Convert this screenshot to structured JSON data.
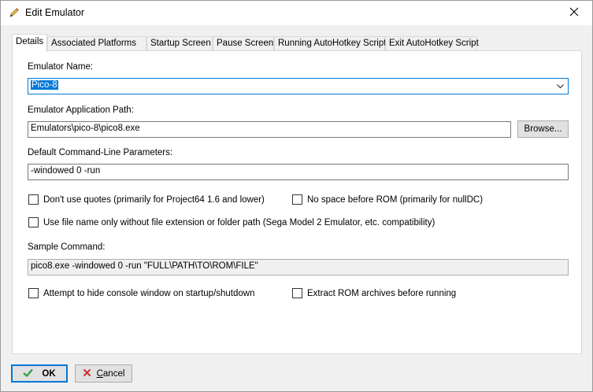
{
  "window": {
    "title": "Edit Emulator",
    "icon": "pencil-icon",
    "close": "close-icon"
  },
  "tabs": [
    {
      "label": "Details",
      "active": true
    },
    {
      "label": "Associated Platforms",
      "active": false
    },
    {
      "label": "Startup Screen",
      "active": false
    },
    {
      "label": "Pause Screen",
      "active": false
    },
    {
      "label": "Running AutoHotkey Script",
      "active": false
    },
    {
      "label": "Exit AutoHotkey Script",
      "active": false
    }
  ],
  "details": {
    "emulator_name_label": "Emulator Name:",
    "emulator_name_value": "Pico-8",
    "app_path_label": "Emulator Application Path:",
    "app_path_value": "Emulators\\pico-8\\pico8.exe",
    "browse_label": "Browse...",
    "cmdline_label": "Default Command-Line Parameters:",
    "cmdline_value": "-windowed 0 -run",
    "no_quotes_label": "Don't use quotes (primarily for Project64 1.6 and lower)",
    "no_space_label": "No space before ROM (primarily for nullDC)",
    "filename_only_label": "Use file name only without file extension or folder path (Sega Model 2 Emulator, etc. compatibility)",
    "sample_label": "Sample Command:",
    "sample_value": "pico8.exe -windowed 0 -run \"FULL\\PATH\\TO\\ROM\\FILE\"",
    "hide_console_label": "Attempt to hide console window on startup/shutdown",
    "extract_rom_label": "Extract ROM archives before running"
  },
  "buttons": {
    "ok": "OK",
    "cancel_prefix": "C",
    "cancel_rest": "ancel",
    "ok_icon": "checkmark-icon",
    "cancel_icon": "x-icon"
  },
  "colors": {
    "accent": "#0078d7",
    "ok_green": "#2e9e3e",
    "cancel_red": "#d03030"
  }
}
